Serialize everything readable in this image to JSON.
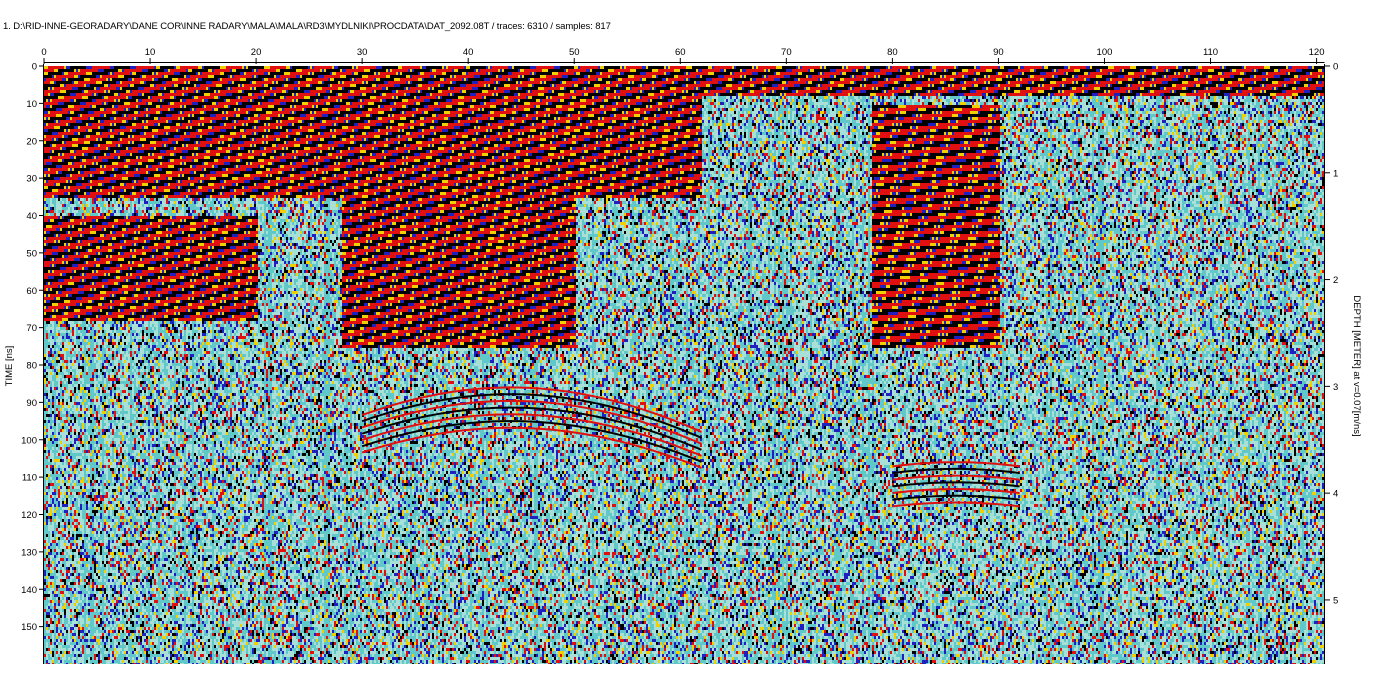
{
  "header": {
    "title": "1. D:\\RID-INNE-GEORADARY\\DANE COR\\INNE RADARY\\MALA\\MALA\\RD3\\MYDLNIKI\\PROCDATA\\DAT_2092.08T / traces: 6310 / samples: 817"
  },
  "chart_data": {
    "type": "heatmap",
    "title": "1. D:\\RID-INNE-GEORADARY\\DANE COR\\INNE RADARY\\MALA\\MALA\\RD3\\MYDLNIKI\\PROCDATA\\DAT_2092.08T / traces: 6310 / samples: 817",
    "traces": 6310,
    "samples": 817,
    "x_axis": {
      "position": "top",
      "range": [
        0,
        120.7
      ],
      "ticks": [
        0,
        10,
        20,
        30,
        40,
        50,
        60,
        70,
        80,
        90,
        100,
        110,
        120
      ],
      "label": ""
    },
    "y_axis_left": {
      "label": "TIME [ns]",
      "range": [
        0,
        160
      ],
      "ticks": [
        0,
        10,
        20,
        30,
        40,
        50,
        60,
        70,
        80,
        90,
        100,
        110,
        120,
        130,
        140,
        150
      ],
      "inverted": true
    },
    "y_axis_right": {
      "label": "DEPTH [METER] at v=0.07[m/ns]",
      "range": [
        0,
        5.6
      ],
      "ticks": [
        0,
        1,
        2,
        3,
        4,
        5
      ],
      "velocity": 0.07
    },
    "colors": {
      "strong_positive": "#e01010",
      "strong_negative": "#000000",
      "mid_positive": "#f0d000",
      "mid_negative": "#2020c0",
      "weak": "#60c8c8",
      "background": "#a8e0d8"
    },
    "features": [
      {
        "kind": "strong-reflection-band",
        "x_range": [
          0,
          62
        ],
        "t_range": [
          0,
          35
        ]
      },
      {
        "kind": "strong-reflection-band",
        "x_range": [
          0,
          20
        ],
        "t_range": [
          40,
          68
        ]
      },
      {
        "kind": "dipping-reflectors",
        "x_range": [
          28,
          50
        ],
        "t_range": [
          20,
          75
        ]
      },
      {
        "kind": "surface-reflection",
        "x_range": [
          62,
          120.7
        ],
        "t_range": [
          0,
          8
        ]
      },
      {
        "kind": "vertical-striping",
        "x_range": [
          78,
          90
        ],
        "t_range": [
          10,
          75
        ]
      },
      {
        "kind": "hyperbola",
        "apex_x": 44,
        "apex_t": 86,
        "x_range": [
          30,
          62
        ],
        "t_range": [
          86,
          160
        ]
      },
      {
        "kind": "hyperbola",
        "apex_x": 86,
        "apex_t": 106,
        "x_range": [
          80,
          92
        ],
        "t_range": [
          106,
          140
        ]
      }
    ]
  }
}
